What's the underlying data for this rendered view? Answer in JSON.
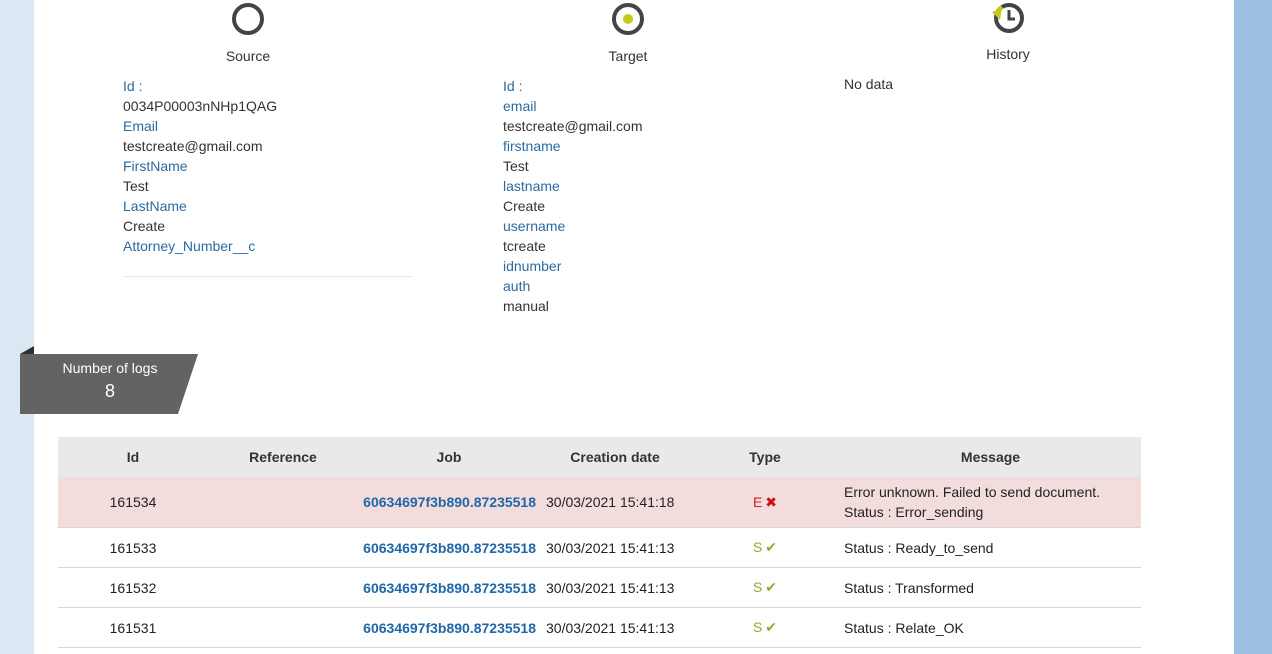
{
  "colors": {
    "link": "#2c6aa0",
    "error_row": "#f3dcdc",
    "success": "#8cad2d",
    "error": "#cc2222",
    "ribbon": "#5f5f5f"
  },
  "source": {
    "title": "Source",
    "fields": [
      {
        "label": "Id :",
        "value": "0034P00003nNHp1QAG"
      },
      {
        "label": "Email",
        "value": "testcreate@gmail.com"
      },
      {
        "label": "FirstName",
        "value": "Test"
      },
      {
        "label": "LastName",
        "value": "Create"
      },
      {
        "label": "Attorney_Number__c",
        "value": ""
      }
    ]
  },
  "target": {
    "title": "Target",
    "fields": [
      {
        "label": "Id :",
        "value": ""
      },
      {
        "label": "email",
        "value": "testcreate@gmail.com"
      },
      {
        "label": "firstname",
        "value": "Test"
      },
      {
        "label": "lastname",
        "value": "Create"
      },
      {
        "label": "username",
        "value": "tcreate"
      },
      {
        "label": "idnumber",
        "value": ""
      },
      {
        "label": "auth",
        "value": "manual"
      }
    ]
  },
  "history": {
    "title": "History",
    "empty_text": "No data"
  },
  "logs_count": {
    "label": "Number of logs",
    "value": "8"
  },
  "logs_table": {
    "headers": [
      "Id",
      "Reference",
      "Job",
      "Creation date",
      "Type",
      "Message"
    ],
    "rows": [
      {
        "id": "161534",
        "reference": "",
        "job": "60634697f3b890.87235518",
        "date": "30/03/2021 15:41:18",
        "type": "E",
        "status": "error",
        "message_line1": "Error unknown. Failed to send document.",
        "message_line2": "Status : Error_sending"
      },
      {
        "id": "161533",
        "reference": "",
        "job": "60634697f3b890.87235518",
        "date": "30/03/2021 15:41:13",
        "type": "S",
        "status": "success",
        "message_line1": "Status : Ready_to_send",
        "message_line2": ""
      },
      {
        "id": "161532",
        "reference": "",
        "job": "60634697f3b890.87235518",
        "date": "30/03/2021 15:41:13",
        "type": "S",
        "status": "success",
        "message_line1": "Status : Transformed",
        "message_line2": ""
      },
      {
        "id": "161531",
        "reference": "",
        "job": "60634697f3b890.87235518",
        "date": "30/03/2021 15:41:13",
        "type": "S",
        "status": "success",
        "message_line1": "Status : Relate_OK",
        "message_line2": ""
      }
    ]
  },
  "icons": {
    "source": "circle-outline-icon",
    "target": "circle-dot-icon",
    "history": "history-clock-icon",
    "error": "cross-icon",
    "success": "check-icon"
  }
}
